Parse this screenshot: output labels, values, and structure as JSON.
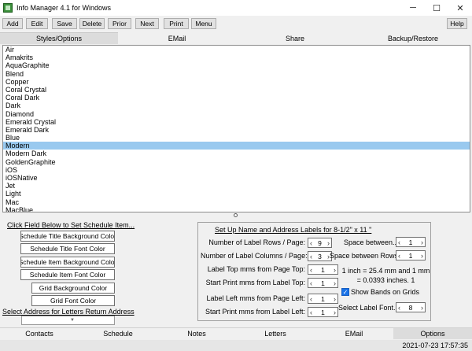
{
  "window": {
    "title": "Info Manager 4.1 for Windows",
    "minimize": "─",
    "maximize": "☐",
    "close": "✕"
  },
  "toolbar": {
    "add": "Add",
    "edit": "Edit",
    "save": "Save",
    "delete": "Delete",
    "prior": "Prior",
    "next": "Next",
    "print": "Print",
    "menu": "Menu",
    "help": "Help"
  },
  "tabs": [
    "Styles/Options",
    "EMail",
    "Share",
    "Backup/Restore"
  ],
  "styles_list": {
    "items": [
      "Air",
      "Amakrits",
      "AquaGraphite",
      "Blend",
      "Copper",
      "Coral Crystal",
      "Coral Dark",
      "Dark",
      "Diamond",
      "Emerald Crystal",
      "Emerald Dark",
      "Blue",
      "Modern",
      "Modern Dark",
      "GoldenGraphite",
      "iOS",
      "iOSNative",
      "Jet",
      "Light",
      "Mac",
      "MacBlue"
    ],
    "selected": "Modern"
  },
  "schedule": {
    "link": "Click Field Below to Set Schedule Item...",
    "buttons": [
      "Schedule Title Background Color",
      "Schedule Title Font Color",
      "Schedule Item Background Color",
      "Schedule Item Font Color",
      "Grid Background Color",
      "Grid Font Color"
    ]
  },
  "address": {
    "link": "Select Address for Letters Return Address",
    "value": ""
  },
  "labels_setup": {
    "title": "Set Up Name and Address Labels for 8-1/2\" x 11 \"",
    "rows_label": "Number of Label Rows  / Page:",
    "rows_value": "9",
    "cols_label": "Number of Label Columns / Page:",
    "cols_value": "3",
    "top_mm_label": "Label Top mms from Page Top:",
    "top_mm_value": "1",
    "start_top_label": "Start Print mms from Label Top:",
    "start_top_value": "1",
    "left_mm_label": "Label Left mms from Page Left:",
    "left_mm_value": "1",
    "start_left_label": "Start Print mms from Label Left:",
    "start_left_value": "1",
    "space_between_label": "Space between...",
    "space_between_value": "1",
    "space_rows_label": "Space between Rows:",
    "space_rows_value": "1",
    "info": "1 inch = 25.4 mm and 1 mm = 0.0393 inches. 1",
    "show_bands_label": "Show Bands on Grids",
    "show_bands_checked": true,
    "font_label": "Select Label Font...",
    "font_value": "8"
  },
  "bottom_tabs": [
    "Contacts",
    "Schedule",
    "Notes",
    "Letters",
    "EMail",
    "Options"
  ],
  "active_bottom_tab": "Options",
  "status": {
    "datetime": "2021-07-23  17:57:35"
  }
}
